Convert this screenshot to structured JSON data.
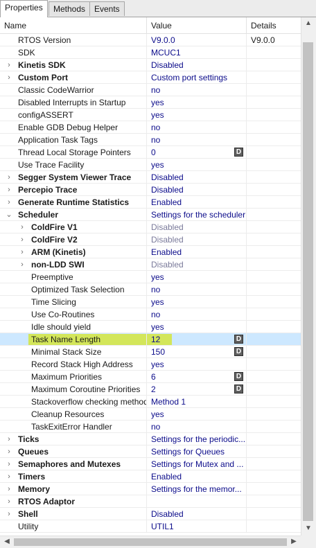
{
  "tabs": [
    {
      "label": "Properties",
      "active": true
    },
    {
      "label": "Methods",
      "active": false
    },
    {
      "label": "Events",
      "active": false
    }
  ],
  "columns": {
    "name": "Name",
    "value": "Value",
    "details": "Details"
  },
  "colors": {
    "selected_row": "#cde8ff",
    "highlight": "#d3e65a",
    "value_text": "#0b0b8a"
  },
  "rows": [
    {
      "name": "RTOS Version",
      "value": "V9.0.0",
      "details": "V9.0.0",
      "level": 0,
      "expander": "",
      "bold": false
    },
    {
      "name": "SDK",
      "value": "MCUC1",
      "details": "",
      "level": 0,
      "expander": "",
      "bold": false
    },
    {
      "name": "Kinetis SDK",
      "value": "Disabled",
      "details": "",
      "level": 0,
      "expander": "›",
      "bold": true
    },
    {
      "name": "Custom Port",
      "value": "Custom port settings",
      "details": "",
      "level": 0,
      "expander": "›",
      "bold": true
    },
    {
      "name": "Classic CodeWarrior",
      "value": "no",
      "details": "",
      "level": 0,
      "expander": "",
      "bold": false
    },
    {
      "name": "Disabled Interrupts in Startup",
      "value": "yes",
      "details": "",
      "level": 0,
      "expander": "",
      "bold": false
    },
    {
      "name": "configASSERT",
      "value": "yes",
      "details": "",
      "level": 0,
      "expander": "",
      "bold": false
    },
    {
      "name": "Enable GDB Debug Helper",
      "value": "no",
      "details": "",
      "level": 0,
      "expander": "",
      "bold": false
    },
    {
      "name": "Application Task Tags",
      "value": "no",
      "details": "",
      "level": 0,
      "expander": "",
      "bold": false
    },
    {
      "name": "Thread Local Storage Pointers",
      "value": "0",
      "details": "",
      "level": 0,
      "expander": "",
      "bold": false,
      "d_button": "D"
    },
    {
      "name": "Use Trace Facility",
      "value": "yes",
      "details": "",
      "level": 0,
      "expander": "",
      "bold": false
    },
    {
      "name": "Segger System Viewer Trace",
      "value": "Disabled",
      "details": "",
      "level": 0,
      "expander": "›",
      "bold": true
    },
    {
      "name": "Percepio Trace",
      "value": "Disabled",
      "details": "",
      "level": 0,
      "expander": "›",
      "bold": true
    },
    {
      "name": "Generate Runtime Statistics",
      "value": "Enabled",
      "details": "",
      "level": 0,
      "expander": "›",
      "bold": true
    },
    {
      "name": "Scheduler",
      "value": "Settings for the scheduler",
      "details": "",
      "level": 0,
      "expander": "⌄",
      "bold": true
    },
    {
      "name": "ColdFire V1",
      "value": "Disabled",
      "details": "",
      "level": 1,
      "expander": "›",
      "bold": true,
      "grey": true
    },
    {
      "name": "ColdFire V2",
      "value": "Disabled",
      "details": "",
      "level": 1,
      "expander": "›",
      "bold": true,
      "grey": true
    },
    {
      "name": "ARM (Kinetis)",
      "value": "Enabled",
      "details": "",
      "level": 1,
      "expander": "›",
      "bold": true
    },
    {
      "name": "non-LDD SWI",
      "value": "Disabled",
      "details": "",
      "level": 1,
      "expander": "›",
      "bold": true,
      "grey": true
    },
    {
      "name": "Preemptive",
      "value": "yes",
      "details": "",
      "level": 1,
      "expander": "",
      "bold": false
    },
    {
      "name": "Optimized Task Selection",
      "value": "no",
      "details": "",
      "level": 1,
      "expander": "",
      "bold": false
    },
    {
      "name": "Time Slicing",
      "value": "yes",
      "details": "",
      "level": 1,
      "expander": "",
      "bold": false
    },
    {
      "name": "Use Co-Routines",
      "value": "no",
      "details": "",
      "level": 1,
      "expander": "",
      "bold": false
    },
    {
      "name": "Idle should yield",
      "value": "yes",
      "details": "",
      "level": 1,
      "expander": "",
      "bold": false
    },
    {
      "name": "Task Name Length",
      "value": "12",
      "details": "",
      "level": 1,
      "expander": "",
      "bold": false,
      "d_button": "D",
      "selected": true,
      "highlighted": true
    },
    {
      "name": "Minimal Stack Size",
      "value": "150",
      "details": "",
      "level": 1,
      "expander": "",
      "bold": false,
      "d_button": "D"
    },
    {
      "name": "Record Stack High Address",
      "value": "yes",
      "details": "",
      "level": 1,
      "expander": "",
      "bold": false
    },
    {
      "name": "Maximum Priorities",
      "value": "6",
      "details": "",
      "level": 1,
      "expander": "",
      "bold": false,
      "d_button": "D"
    },
    {
      "name": "Maximum Coroutine Priorities",
      "value": "2",
      "details": "",
      "level": 1,
      "expander": "",
      "bold": false,
      "d_button": "D"
    },
    {
      "name": "Stackoverflow checking method",
      "value": "Method 1",
      "details": "",
      "level": 1,
      "expander": "",
      "bold": false
    },
    {
      "name": "Cleanup Resources",
      "value": "yes",
      "details": "",
      "level": 1,
      "expander": "",
      "bold": false
    },
    {
      "name": "TaskExitError Handler",
      "value": "no",
      "details": "",
      "level": 1,
      "expander": "",
      "bold": false
    },
    {
      "name": "Ticks",
      "value": "Settings for the periodic...",
      "details": "",
      "level": 0,
      "expander": "›",
      "bold": true
    },
    {
      "name": "Queues",
      "value": "Settings for Queues",
      "details": "",
      "level": 0,
      "expander": "›",
      "bold": true
    },
    {
      "name": "Semaphores and Mutexes",
      "value": "Settings for Mutex and ...",
      "details": "",
      "level": 0,
      "expander": "›",
      "bold": true
    },
    {
      "name": "Timers",
      "value": "Enabled",
      "details": "",
      "level": 0,
      "expander": "›",
      "bold": true
    },
    {
      "name": "Memory",
      "value": "Settings for the memor...",
      "details": "",
      "level": 0,
      "expander": "›",
      "bold": true
    },
    {
      "name": "RTOS Adaptor",
      "value": "",
      "details": "",
      "level": 0,
      "expander": "›",
      "bold": true
    },
    {
      "name": "Shell",
      "value": "Disabled",
      "details": "",
      "level": 0,
      "expander": "›",
      "bold": true
    },
    {
      "name": "Utility",
      "value": "UTIL1",
      "details": "",
      "level": 0,
      "expander": "",
      "bold": false
    }
  ],
  "scroll_icons": {
    "up": "▲",
    "down": "▼",
    "left": "◀",
    "right": "▶"
  }
}
